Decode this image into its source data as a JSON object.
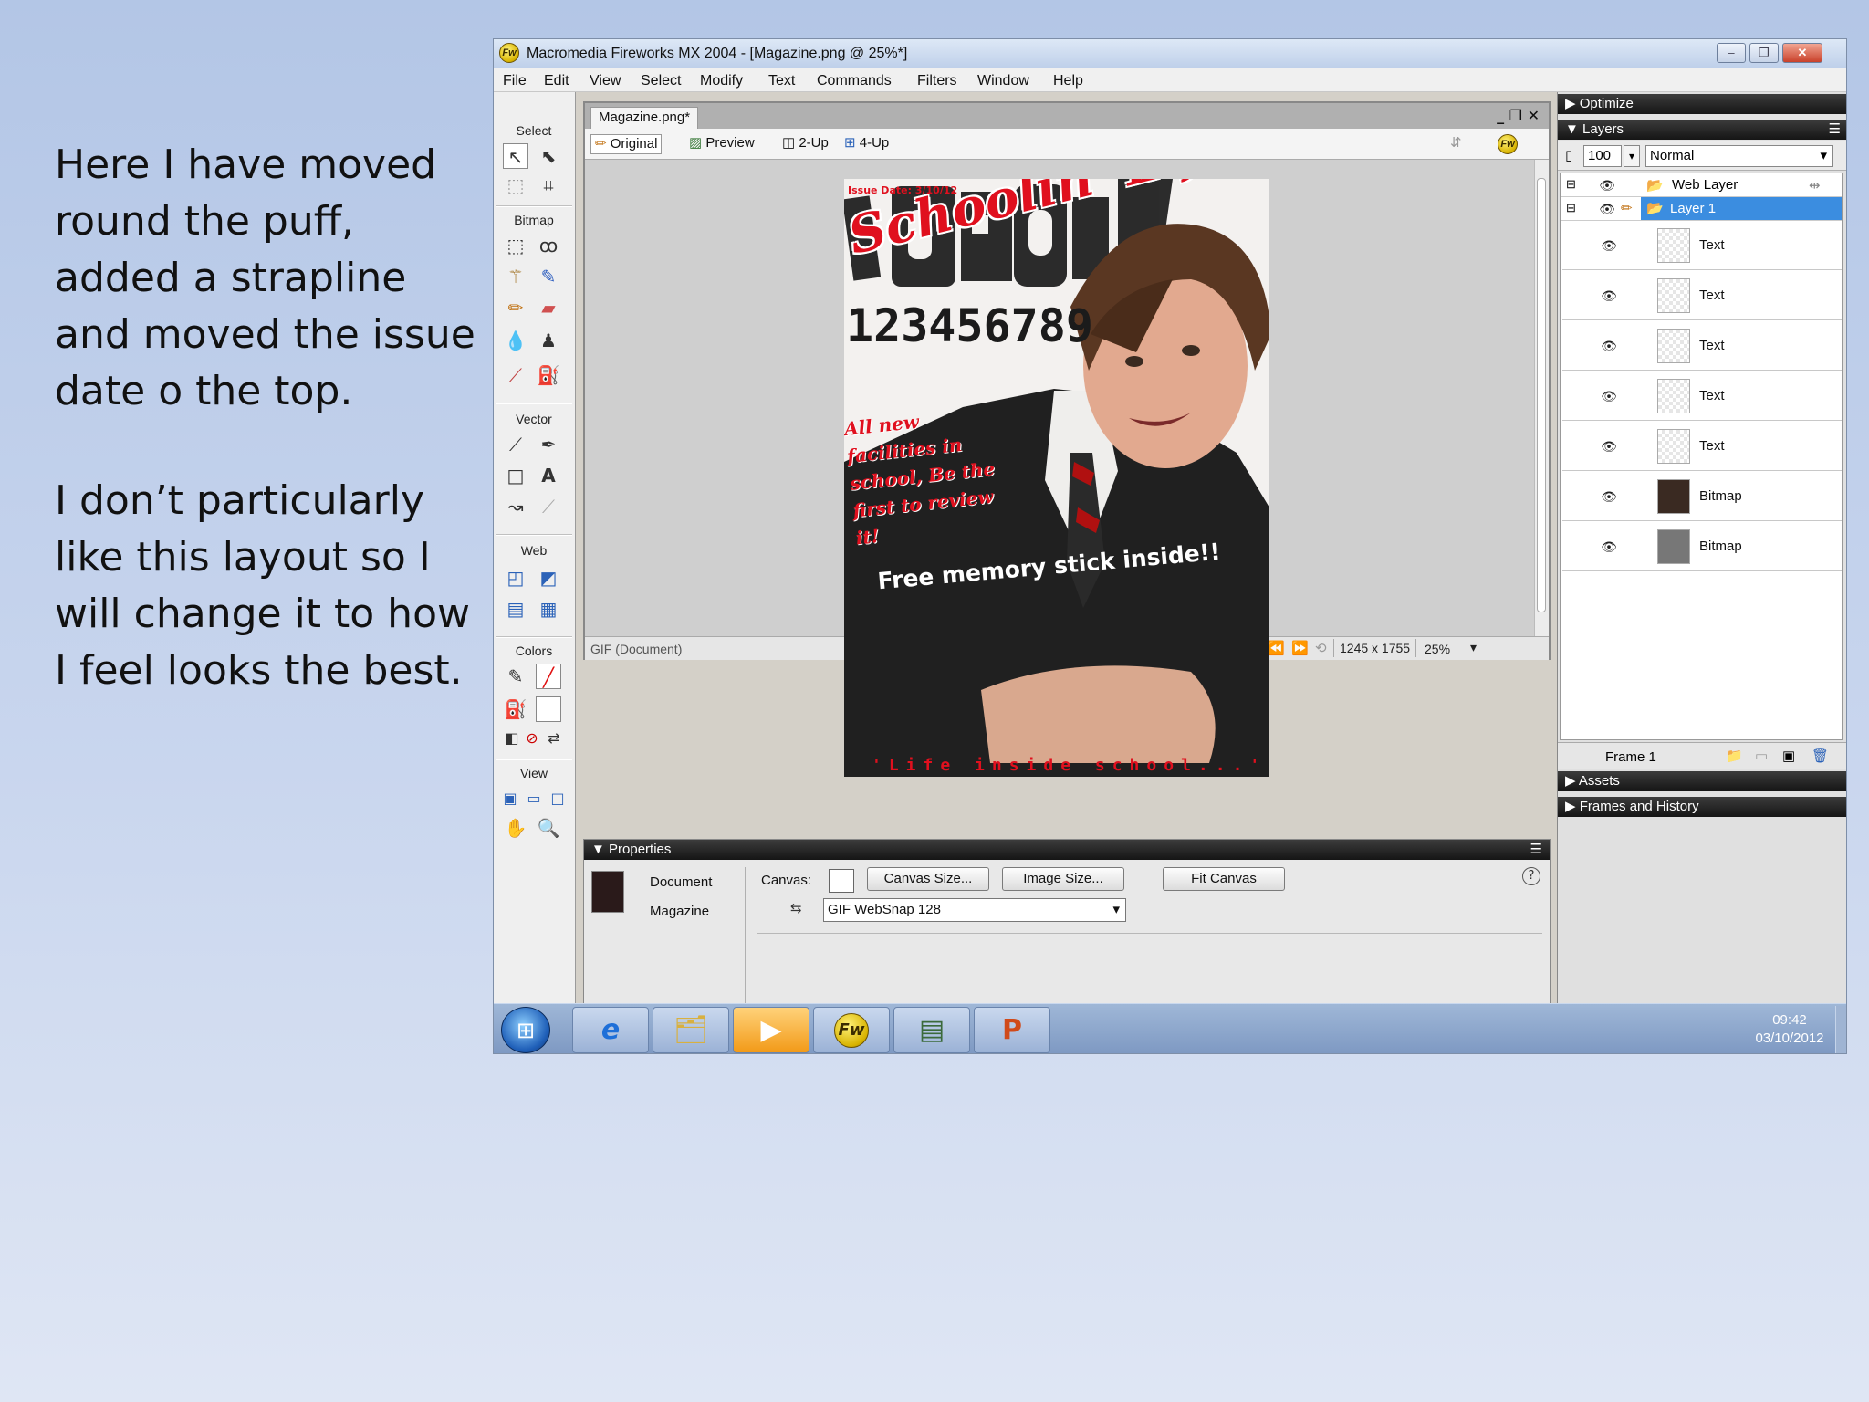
{
  "slide": {
    "paragraphs": [
      "Here I have moved round the puff, added a strapline and moved the issue date o the top.",
      "I don’t particularly like this layout so I will change it to how I feel looks the best."
    ]
  },
  "window": {
    "title": "Macromedia Fireworks MX 2004 - [Magazine.png @ 25%*]",
    "logo": "Fw",
    "controls": [
      "minimize-icon",
      "restore-icon",
      "close-icon"
    ]
  },
  "menu": [
    "File",
    "Edit",
    "View",
    "Select",
    "Modify",
    "Text",
    "Commands",
    "Filters",
    "Window",
    "Help"
  ],
  "tools": {
    "sections": [
      "Select",
      "Bitmap",
      "Vector",
      "Web",
      "Colors",
      "View"
    ]
  },
  "document": {
    "tab": "Magazine.png*",
    "views": [
      "Original",
      "Preview",
      "2-Up",
      "4-Up"
    ],
    "status_format": "GIF (Document)",
    "frame": "1",
    "size": "1245 x 1755",
    "zoom": "25%"
  },
  "cover": {
    "issue": "Issue Date: 3/10/12",
    "masthead": "Schoolin' Life",
    "numbers": "123456789",
    "puff": "All new facilities in school, Be the first to review it!",
    "strapline": "Free memory stick inside!!",
    "footer": "'Life inside school...'",
    "colors": {
      "red": "#e0101e",
      "dark": "#1b1b1b"
    }
  },
  "properties": {
    "header": "Properties",
    "doc_type": "Document",
    "doc_name": "Magazine",
    "canvas_label": "Canvas:",
    "canvas_size": "Canvas Size...",
    "image_size": "Image Size...",
    "fit_canvas": "Fit Canvas",
    "optimize_setting": "GIF WebSnap 128",
    "help": "?"
  },
  "panels": {
    "optimize": "Optimize",
    "layers": "Layers",
    "opacity": "100",
    "blend": "Normal",
    "layer_rows": [
      {
        "name": "Web Layer"
      },
      {
        "name": "Layer 1"
      }
    ],
    "objects": [
      "Text",
      "Text",
      "Text",
      "Text",
      "Text",
      "Bitmap",
      "Bitmap"
    ],
    "frame": "Frame 1",
    "assets": "Assets",
    "frames_history": "Frames and History"
  },
  "taskbar": {
    "time": "09:42",
    "date": "03/10/2012",
    "apps": [
      "start-orb-icon",
      "internet-explorer-icon",
      "file-explorer-icon",
      "media-player-icon",
      "fireworks-icon",
      "app-window-icon",
      "powerpoint-icon"
    ]
  }
}
